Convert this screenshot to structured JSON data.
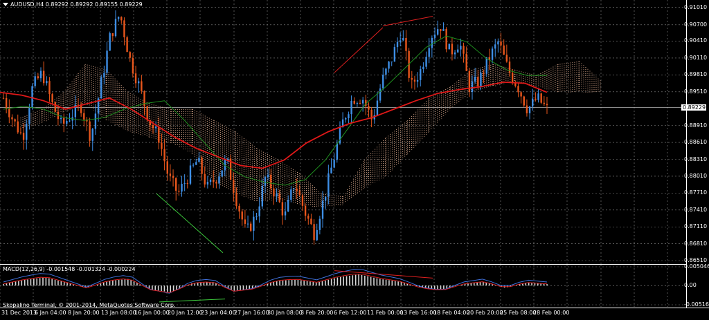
{
  "header": {
    "symbol": "AUDUSD,H4",
    "ohlc": "0.89292 0.89292 0.89155 0.89229"
  },
  "macd": {
    "label": "MACD(12,26,9) -0.001548 -0.001324 -0.000224",
    "scale": [
      "0.005046",
      "0.00",
      "-0.005162"
    ]
  },
  "copyright": "Skopalino Terminal, © 2001-2014, MetaQuotes Software Corp.",
  "price_axis": [
    "0.91010",
    "0.90700",
    "0.90410",
    "0.90110",
    "0.89810",
    "0.89510",
    "0.89229",
    "0.88910",
    "0.88610",
    "0.88310",
    "0.88010",
    "0.87710",
    "0.87410",
    "0.87110",
    "0.86810",
    "0.86510"
  ],
  "current_price": "0.89229",
  "time_axis": [
    "31 Dec 2013",
    "6 Jan 04:00",
    "8 Jan 20:00",
    "13 Jan 08:00",
    "16 Jan 00:00",
    "20 Jan 12:00",
    "23 Jan 04:00",
    "27 Jan 16:00",
    "30 Jan 08:00",
    "3 Feb 20:00",
    "6 Feb 12:00",
    "11 Feb 00:00",
    "13 Feb 16:00",
    "18 Feb 04:00",
    "20 Feb 20:00",
    "25 Feb 08:00",
    "28 Feb 00:00"
  ],
  "colors": {
    "bull": "#3e8fe6",
    "bear": "#e8561c",
    "ma_fast": "#1f8f1f",
    "ma_slow": "#e01818",
    "cloud": "#d9a88c",
    "grid": "#8a8a8a",
    "macd_hist": "#d9d9d9",
    "macd_main": "#3f6fd8",
    "macd_signal": "#d82020"
  },
  "chart_data": {
    "type": "candlestick",
    "symbol": "AUDUSD",
    "timeframe": "H4",
    "ylim": [
      0.8645,
      0.9114
    ],
    "close_path": [
      0.894,
      0.89,
      0.887,
      0.896,
      0.8985,
      0.893,
      0.889,
      0.891,
      0.8925,
      0.887,
      0.896,
      0.905,
      0.909,
      0.901,
      0.896,
      0.89,
      0.887,
      0.88,
      0.877,
      0.88,
      0.883,
      0.878,
      0.88,
      0.883,
      0.876,
      0.87,
      0.873,
      0.88,
      0.877,
      0.873,
      0.879,
      0.874,
      0.87,
      0.876,
      0.883,
      0.89,
      0.894,
      0.894,
      0.89,
      0.897,
      0.901,
      0.906,
      0.896,
      0.899,
      0.905,
      0.907,
      0.902,
      0.904,
      0.896,
      0.897,
      0.901,
      0.904,
      0.899,
      0.896,
      0.892,
      0.894,
      0.892
    ],
    "ma_fast_path": [
      0.892,
      0.8925,
      0.892,
      0.8905,
      0.89,
      0.8905,
      0.892,
      0.893,
      0.8935,
      0.89,
      0.886,
      0.882,
      0.88,
      0.879,
      0.8785,
      0.8795,
      0.883,
      0.888,
      0.893,
      0.896,
      0.8995,
      0.903,
      0.905,
      0.904,
      0.901,
      0.899,
      0.898,
      0.898
    ],
    "ma_slow_path": [
      0.895,
      0.8945,
      0.8935,
      0.892,
      0.893,
      0.894,
      0.892,
      0.8895,
      0.887,
      0.885,
      0.8835,
      0.882,
      0.8815,
      0.883,
      0.886,
      0.888,
      0.8895,
      0.8905,
      0.892,
      0.8935,
      0.8948,
      0.8955,
      0.896,
      0.8968,
      0.8966,
      0.895
    ],
    "macd_hist_path": [
      0.0004,
      0.0015,
      0.0022,
      0.0008,
      -0.0006,
      0.0012,
      0.0018,
      -0.001,
      -0.0018,
      0.0006,
      0.001,
      -0.0014,
      -0.0008,
      0.0012,
      0.0016,
      0.0008,
      0.0022,
      0.003,
      0.0018,
      0.001,
      -0.0006,
      -0.0012,
      0.0004,
      0.001,
      -0.0006,
      0.0008,
      0.0004
    ]
  }
}
